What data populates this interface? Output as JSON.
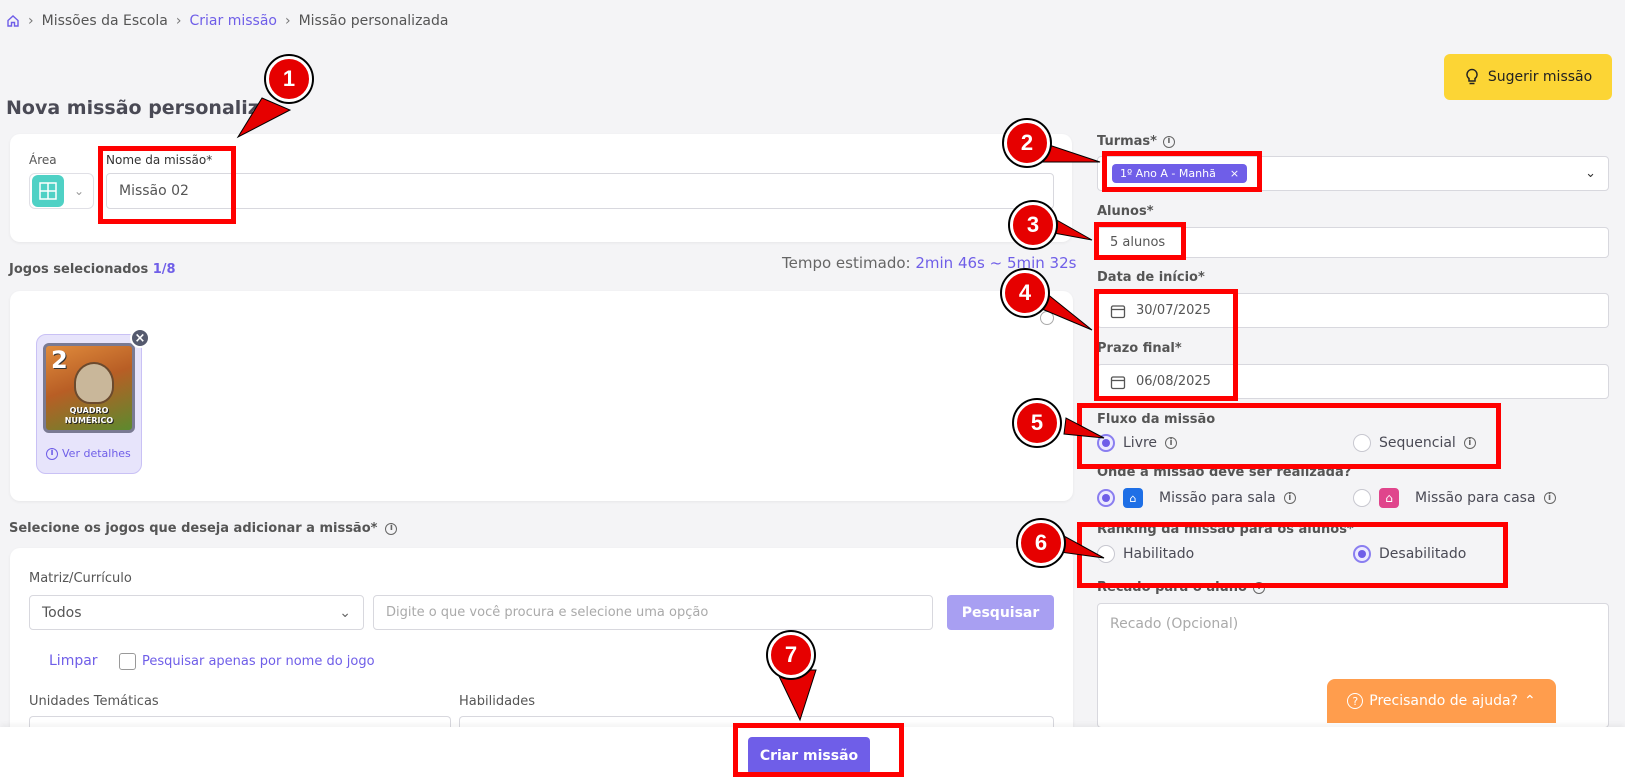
{
  "breadcrumb": {
    "items": [
      "Missões da Escola",
      "Criar missão",
      "Missão personalizada"
    ]
  },
  "header": {
    "page_title": "Nova missão personalizada",
    "suggest_label": "Sugerir missão"
  },
  "mission": {
    "area_label": "Área",
    "name_label": "Nome da missão*",
    "name_value": "Missão 02"
  },
  "games": {
    "selected_label": "Jogos selecionados",
    "selected_count": "1/8",
    "time_label": "Tempo estimado:",
    "time_value": "2min 46s ~ 5min 32s",
    "card": {
      "number": "2",
      "title": "QUADRO NUMÉRICO",
      "details_label": "Ver detalhes"
    }
  },
  "filters": {
    "section_label": "Selecione os jogos que deseja adicionar a missão*",
    "matriz_label": "Matriz/Currículo",
    "matriz_value": "Todos",
    "search_placeholder": "Digite o que você procura e selecione uma opção",
    "search_button": "Pesquisar",
    "clear_label": "Limpar",
    "name_only_label": "Pesquisar apenas por nome do jogo",
    "unidades_label": "Unidades Temáticas",
    "habilidades_label": "Habilidades"
  },
  "turmas": {
    "label": "Turmas*",
    "tag": "1º Ano A - Manhã"
  },
  "alunos": {
    "label": "Alunos*",
    "value": "5 alunos"
  },
  "dates": {
    "start_label": "Data de início*",
    "start_value": "30/07/2025",
    "end_label": "Prazo final*",
    "end_value": "06/08/2025"
  },
  "flow": {
    "label": "Fluxo da missão",
    "free": "Livre",
    "sequential": "Sequencial"
  },
  "location": {
    "label": "Onde a missão deve ser realizada?",
    "room": "Missão para sala",
    "home": "Missão para casa"
  },
  "ranking": {
    "label": "Ranking da missão para os alunos*",
    "enabled": "Habilitado",
    "disabled": "Desabilitado"
  },
  "message": {
    "label": "Recado para o aluno",
    "placeholder": "Recado (Opcional)"
  },
  "help": {
    "label": "Precisando de ajuda?"
  },
  "footer": {
    "create_label": "Criar missão"
  },
  "annotations": [
    "1",
    "2",
    "3",
    "4",
    "5",
    "6",
    "7"
  ],
  "colors": {
    "accent": "#6f5ee8",
    "annotation": "#ff0000",
    "suggest": "#fcd535",
    "help": "#ff9d4d"
  }
}
